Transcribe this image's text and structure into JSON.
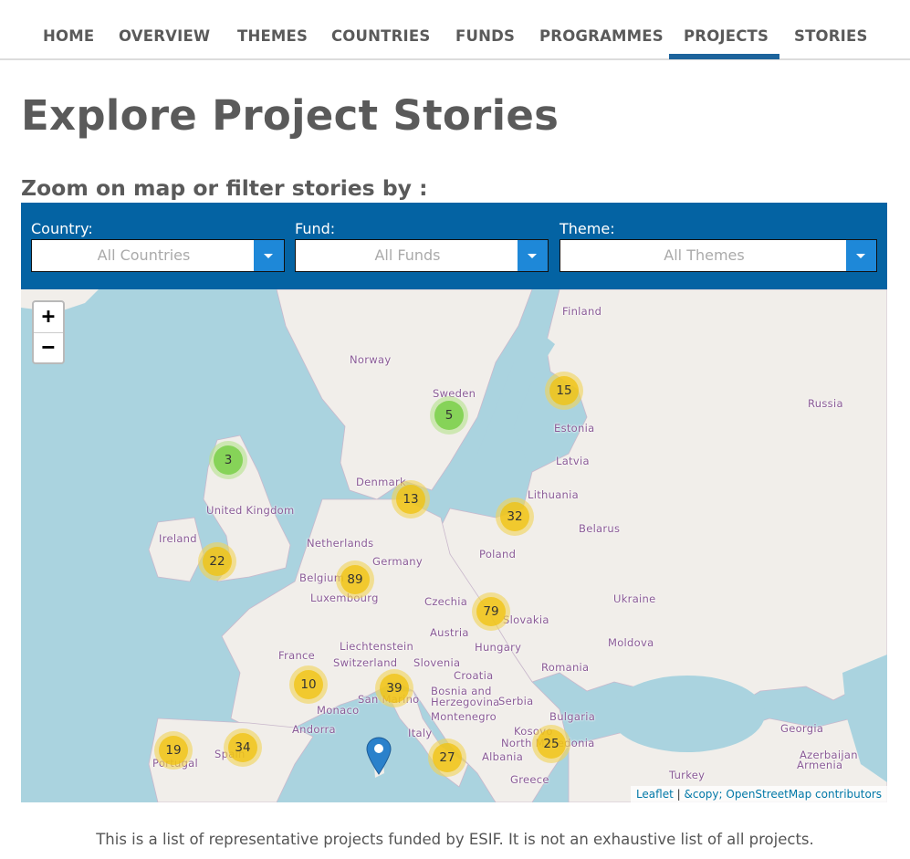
{
  "nav": {
    "items": [
      "HOME",
      "OVERVIEW",
      "THEMES",
      "COUNTRIES",
      "FUNDS",
      "PROGRAMMES",
      "PROJECTS",
      "STORIES"
    ],
    "active": "PROJECTS",
    "accent_color": "#1d649c"
  },
  "page": {
    "title": "Explore Project Stories",
    "subtitle": "Zoom on map or filter stories by :"
  },
  "filters": {
    "bar_color": "#0463a3",
    "country": {
      "label": "Country:",
      "value": "All Countries"
    },
    "fund": {
      "label": "Fund:",
      "value": "All Funds"
    },
    "theme": {
      "label": "Theme:",
      "value": "All Themes"
    }
  },
  "map": {
    "zoom_in": "+",
    "zoom_out": "−",
    "country_labels": [
      "Finland",
      "Norway",
      "Sweden",
      "Russia",
      "Estonia",
      "Latvia",
      "Denmark",
      "Lithuania",
      "United Kingdom",
      "Belarus",
      "Ireland",
      "Netherlands",
      "Poland",
      "Germany",
      "Belgium",
      "Luxembourg",
      "Czechia",
      "Ukraine",
      "Slovakia",
      "Austria",
      "Hungary",
      "Moldova",
      "France",
      "Liechtenstein",
      "Switzerland",
      "Slovenia",
      "Romania",
      "Croatia",
      "Bosnia and Herzegovina",
      "Serbia",
      "San Marino",
      "Monaco",
      "Montenegro",
      "Bulgaria",
      "Andorra",
      "Italy",
      "Kosovo",
      "North Macedonia",
      "Georgia",
      "Spain",
      "Portugal",
      "Albania",
      "Azerbaijan",
      "Armenia",
      "Greece",
      "Turkey"
    ],
    "clusters": [
      {
        "count": "15",
        "size": "medium"
      },
      {
        "count": "5",
        "size": "small"
      },
      {
        "count": "3",
        "size": "small"
      },
      {
        "count": "13",
        "size": "medium"
      },
      {
        "count": "32",
        "size": "medium"
      },
      {
        "count": "22",
        "size": "medium"
      },
      {
        "count": "89",
        "size": "medium"
      },
      {
        "count": "79",
        "size": "medium"
      },
      {
        "count": "10",
        "size": "medium"
      },
      {
        "count": "39",
        "size": "medium"
      },
      {
        "count": "19",
        "size": "medium"
      },
      {
        "count": "34",
        "size": "medium"
      },
      {
        "count": "27",
        "size": "medium"
      },
      {
        "count": "25",
        "size": "medium"
      }
    ],
    "single_markers": 1,
    "attribution": {
      "leaflet": "Leaflet",
      "separator": "|",
      "osm": "&copy; OpenStreetMap contributors"
    }
  },
  "footer": {
    "note": "This is a list of representative projects funded by ESIF. It is not an exhaustive list of all projects."
  }
}
